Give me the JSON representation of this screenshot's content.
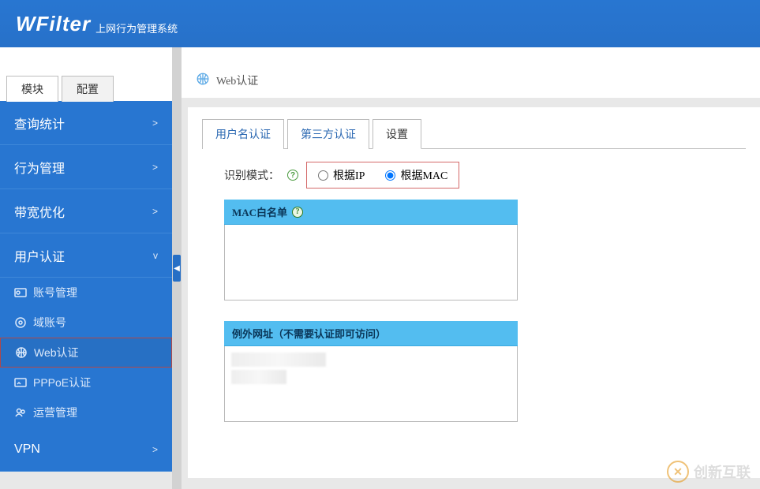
{
  "header": {
    "logo": "WFilter",
    "subtitle": "上网行为管理系统"
  },
  "sidebar": {
    "top_tabs": [
      {
        "label": "模块",
        "active": true
      },
      {
        "label": "配置",
        "active": false
      }
    ],
    "sections": [
      {
        "label": "查询统计",
        "expanded": false
      },
      {
        "label": "行为管理",
        "expanded": false
      },
      {
        "label": "带宽优化",
        "expanded": false
      },
      {
        "label": "用户认证",
        "expanded": true,
        "items": [
          {
            "label": "账号管理",
            "icon": "id-card"
          },
          {
            "label": "域账号",
            "icon": "at"
          },
          {
            "label": "Web认证",
            "icon": "globe",
            "selected": true
          },
          {
            "label": "PPPoE认证",
            "icon": "key"
          },
          {
            "label": "运营管理",
            "icon": "users"
          }
        ]
      },
      {
        "label": "VPN",
        "expanded": false
      }
    ]
  },
  "page": {
    "title": "Web认证"
  },
  "tabs": [
    {
      "label": "用户名认证",
      "active": false
    },
    {
      "label": "第三方认证",
      "active": false
    },
    {
      "label": "设置",
      "active": true
    }
  ],
  "settings": {
    "mode_label": "识别模式：",
    "mode_options": [
      {
        "label": "根据IP",
        "checked": false
      },
      {
        "label": "根据MAC",
        "checked": true
      }
    ],
    "whitelist_title": "MAC白名单",
    "exception_title": "例外网址（不需要认证即可访问）"
  },
  "watermark": {
    "text": "创新互联"
  }
}
